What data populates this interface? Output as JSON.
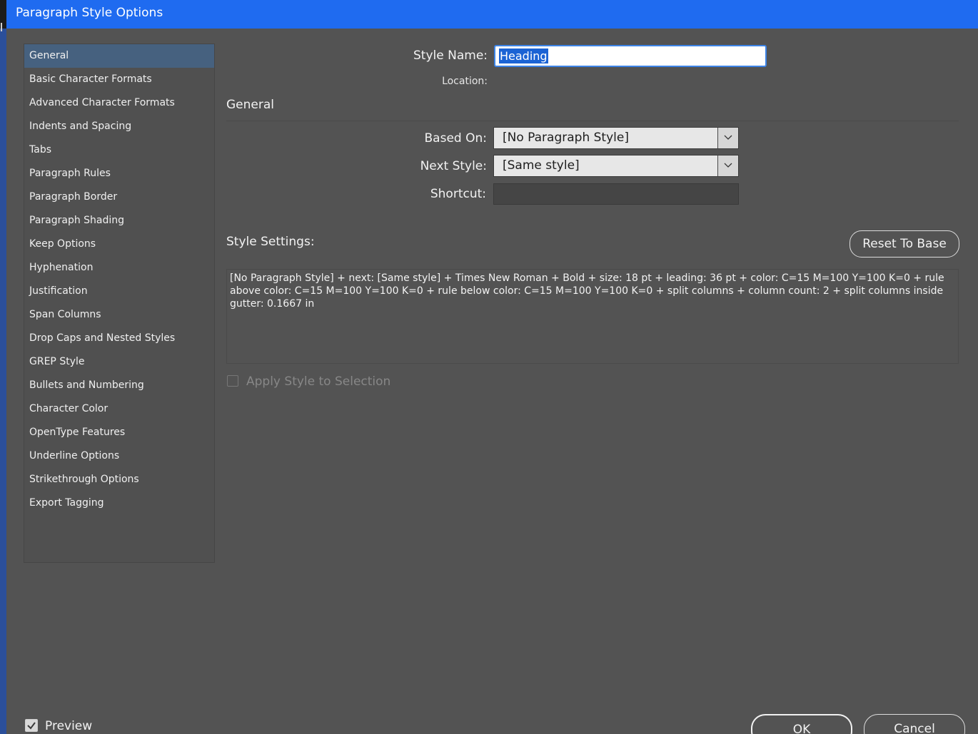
{
  "window": {
    "title": "Paragraph Style Options"
  },
  "sidebar": {
    "items": [
      {
        "label": "General",
        "active": true
      },
      {
        "label": "Basic Character Formats"
      },
      {
        "label": "Advanced Character Formats"
      },
      {
        "label": "Indents and Spacing"
      },
      {
        "label": "Tabs"
      },
      {
        "label": "Paragraph Rules"
      },
      {
        "label": "Paragraph Border"
      },
      {
        "label": "Paragraph Shading"
      },
      {
        "label": "Keep Options"
      },
      {
        "label": "Hyphenation"
      },
      {
        "label": "Justification"
      },
      {
        "label": "Span Columns"
      },
      {
        "label": "Drop Caps and Nested Styles"
      },
      {
        "label": "GREP Style"
      },
      {
        "label": "Bullets and Numbering"
      },
      {
        "label": "Character Color"
      },
      {
        "label": "OpenType Features"
      },
      {
        "label": "Underline Options"
      },
      {
        "label": "Strikethrough Options"
      },
      {
        "label": "Export Tagging"
      }
    ]
  },
  "form": {
    "style_name_label": "Style Name:",
    "style_name_value": "Heading",
    "location_label": "Location:",
    "section_title": "General",
    "based_on_label": "Based On:",
    "based_on_value": "[No Paragraph Style]",
    "next_style_label": "Next Style:",
    "next_style_value": "[Same style]",
    "shortcut_label": "Shortcut:",
    "shortcut_value": ""
  },
  "style_settings": {
    "label": "Style Settings:",
    "reset_button": "Reset To Base",
    "text": "[No Paragraph Style] + next: [Same style] + Times New Roman + Bold + size: 18 pt + leading: 36 pt + color: C=15 M=100 Y=100 K=0 + rule above color: C=15 M=100 Y=100 K=0 + rule below color: C=15 M=100 Y=100 K=0 + split columns + column count: 2 + split columns inside gutter: 0.1667 in"
  },
  "apply_style": {
    "label": "Apply Style to Selection",
    "checked": false,
    "enabled": false
  },
  "footer": {
    "preview_label": "Preview",
    "preview_checked": true,
    "ok_button": "OK",
    "cancel_button": "Cancel"
  },
  "colors": {
    "title_bar": "#1f6bf0",
    "panel": "#535353",
    "selection": "#46617f",
    "text_selection": "#1b63d4"
  }
}
